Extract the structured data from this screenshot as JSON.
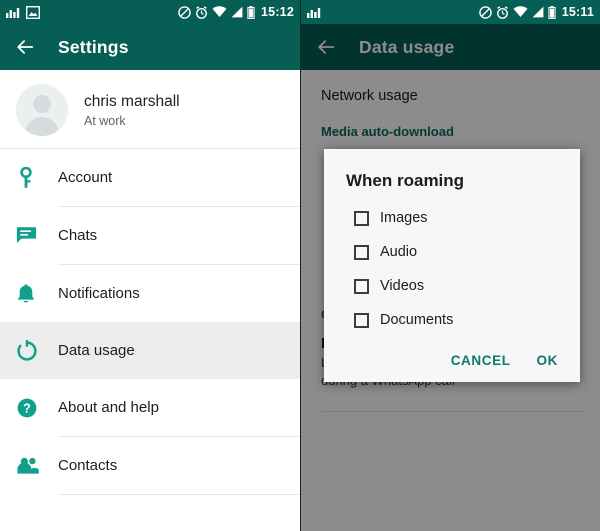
{
  "colors": {
    "brand_teal": "#075e55",
    "accent_teal": "#0b7a6c",
    "icon_teal": "#11a08c",
    "row_active_bg": "#ececec",
    "dialog_bg": "#f7f7f7",
    "scrim": "rgba(0,0,0,0.45)"
  },
  "left_panel": {
    "statusbar": {
      "time": "15:12",
      "left_icons": [
        "equalizer-icon",
        "photo-icon"
      ],
      "right_icons": [
        "mute-icon",
        "alarm-icon",
        "wifi-icon",
        "signal-icon",
        "battery-icon"
      ]
    },
    "toolbar": {
      "back_icon": "back-arrow-icon",
      "title": "Settings"
    },
    "profile": {
      "name": "chris marshall",
      "status": "At work",
      "avatar_icon": "default-avatar-icon"
    },
    "items": [
      {
        "label": "Account",
        "icon": "key-icon",
        "active": false
      },
      {
        "label": "Chats",
        "icon": "chat-icon",
        "active": false
      },
      {
        "label": "Notifications",
        "icon": "bell-icon",
        "active": false
      },
      {
        "label": "Data usage",
        "icon": "data-usage-icon",
        "active": true
      },
      {
        "label": "About and help",
        "icon": "help-circle-icon",
        "active": false
      },
      {
        "label": "Contacts",
        "icon": "contacts-icon",
        "active": false
      }
    ]
  },
  "right_panel": {
    "statusbar": {
      "time": "15:11",
      "left_icons": [
        "equalizer-icon"
      ],
      "right_icons": [
        "mute-icon",
        "alarm-icon",
        "wifi-icon",
        "signal-icon",
        "battery-icon"
      ]
    },
    "toolbar": {
      "back_icon": "back-arrow-icon",
      "title": "Data usage"
    },
    "network_usage_label": "Network usage",
    "media_auto_download_header": "Media auto-download",
    "call_settings_header": "Call settings",
    "low_data_usage": {
      "title": "Low data usage",
      "subtitle": "Lower the amount of data used during a WhatsApp call",
      "checked": false
    }
  },
  "dialog": {
    "title": "When roaming",
    "options": [
      {
        "label": "Images",
        "checked": false
      },
      {
        "label": "Audio",
        "checked": false
      },
      {
        "label": "Videos",
        "checked": false
      },
      {
        "label": "Documents",
        "checked": false
      }
    ],
    "cancel_label": "CANCEL",
    "ok_label": "OK"
  }
}
